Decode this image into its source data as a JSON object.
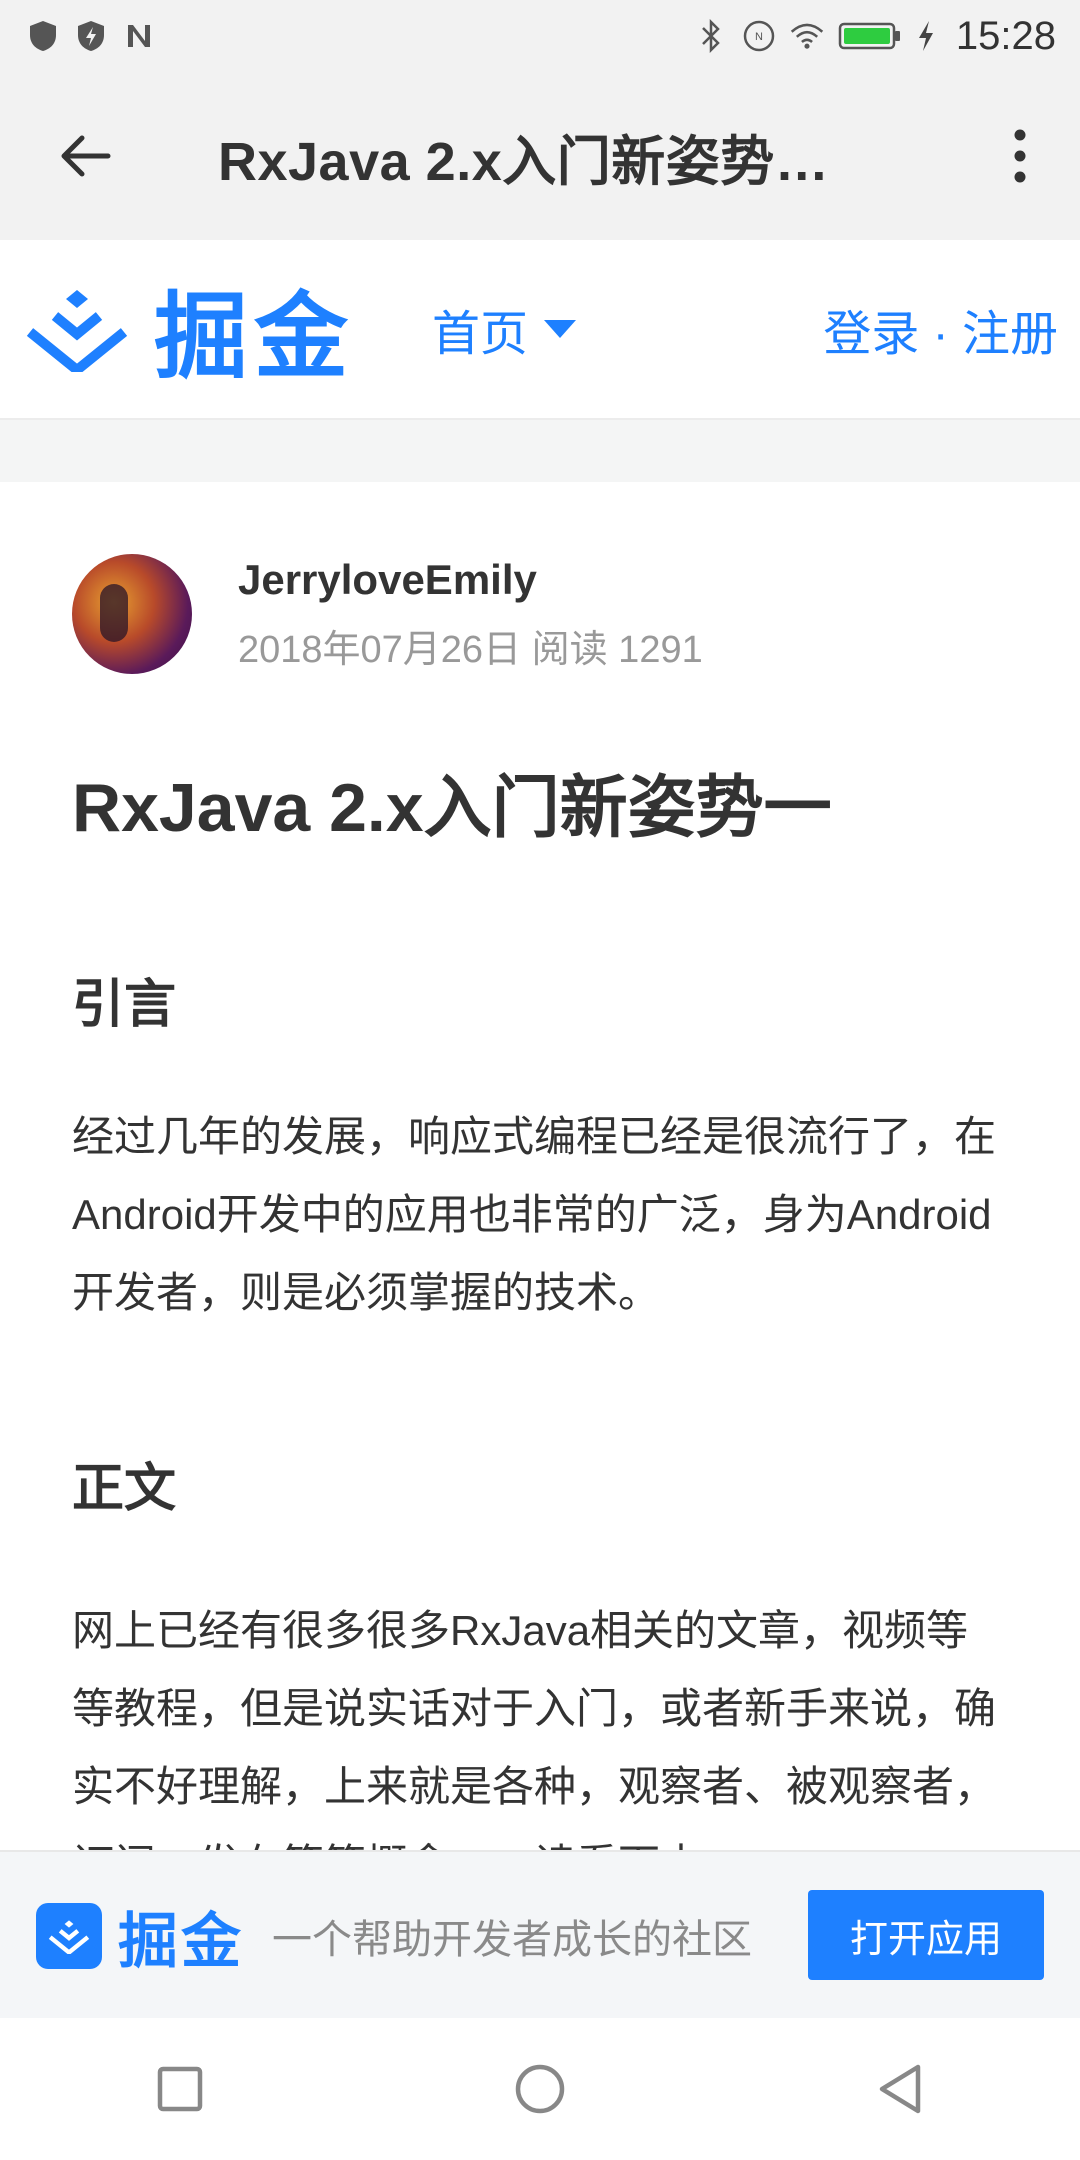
{
  "status_bar": {
    "time": "15:28",
    "left_icons": [
      "shield-icon",
      "shield-flash-icon",
      "n-notification-icon"
    ],
    "right_icons": [
      "bluetooth-icon",
      "nfc-icon",
      "wifi-icon",
      "battery-icon",
      "charging-icon"
    ]
  },
  "toolbar": {
    "title": "RxJava 2.x入门新姿势…"
  },
  "site_header": {
    "logo_text": "掘金",
    "nav_label": "首页",
    "login_text": "登录 · 注册",
    "brand_color": "#1e80ff"
  },
  "article": {
    "author": "JerryloveEmily",
    "meta": "2018年07月26日  阅读 1291",
    "title": "RxJava 2.x入门新姿势一",
    "section1_heading": "引言",
    "section1_text": "经过几年的发展，响应式编程已经是很流行了，在Android开发中的应用也非常的广泛，身为Android开发者，则是必须掌握的技术。",
    "section2_heading": "正文",
    "section2_text": "网上已经有很多很多RxJava相关的文章，视频等等教程，但是说实话对于入门，或者新手来说，确实不好理解，上来就是各种，观察者、被观察者，订阅，发布等等概念，一读看下去"
  },
  "banner": {
    "logo_text": "掘金",
    "slogan": "一个帮助开发者成长的社区",
    "open_button": "打开应用"
  },
  "nav_bar": {
    "buttons": [
      "recent-apps-icon",
      "home-icon",
      "back-triangle-icon"
    ]
  }
}
